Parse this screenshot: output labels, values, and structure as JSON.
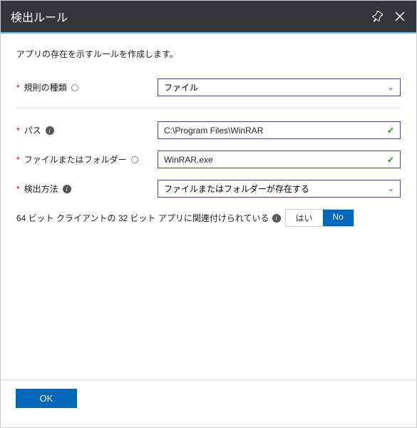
{
  "header": {
    "title": "検出ルール"
  },
  "description": "アプリの存在を示すルールを作成します。",
  "fields": {
    "ruleType": {
      "label": "規則の種類",
      "value": "ファイル"
    },
    "path": {
      "label": "パス",
      "value": "C:\\Program Files\\WinRAR"
    },
    "fileOrFolder": {
      "label": "ファイルまたはフォルダー",
      "value": "WinRAR.exe"
    },
    "detectionMethod": {
      "label": "検出方法",
      "value": "ファイルまたはフォルダーが存在する"
    }
  },
  "toggle": {
    "label": "64 ビット クライアントの 32 ビット アプリに関連付けられている",
    "yes": "はい",
    "no": "No"
  },
  "footer": {
    "ok": "OK"
  }
}
